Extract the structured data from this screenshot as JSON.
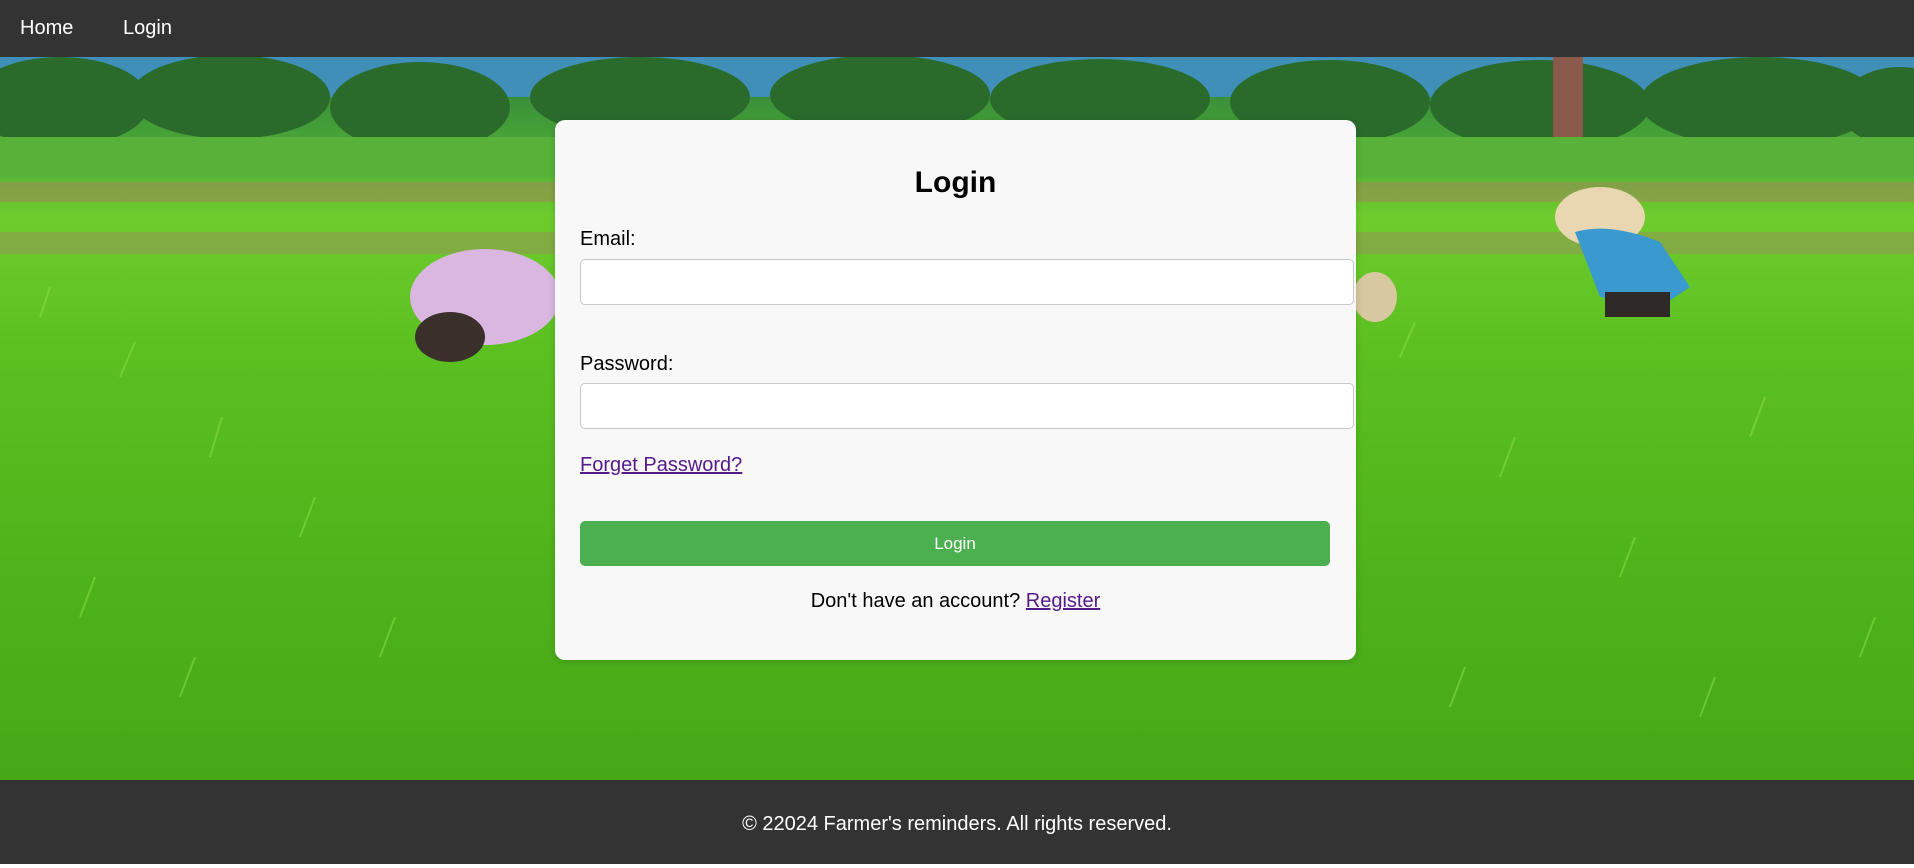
{
  "nav": {
    "home_label": "Home",
    "login_label": "Login"
  },
  "login_form": {
    "title": "Login",
    "email_label": "Email:",
    "email_value": "",
    "password_label": "Password:",
    "password_value": "",
    "forgot_password_label": "Forget Password?",
    "submit_label": "Login",
    "register_prompt": "Don't have an account?",
    "register_link_label": "Register"
  },
  "footer": {
    "copyright": "© 22024 Farmer's reminders. All rights reserved."
  },
  "colors": {
    "navbar_bg": "#333333",
    "button_green": "#4caf50",
    "link_visited": "#551a8b",
    "card_bg": "#f8f8f8"
  }
}
